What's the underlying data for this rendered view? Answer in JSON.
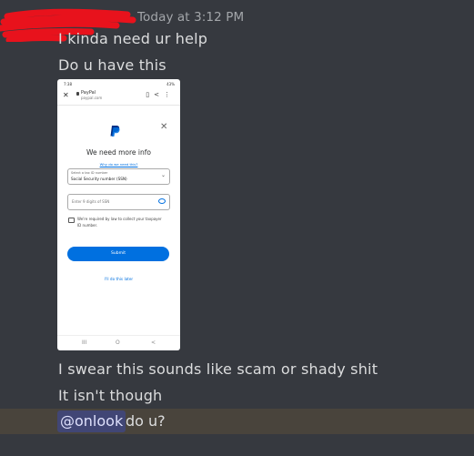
{
  "header": {
    "timestamp": "Today at 3:12 PM"
  },
  "messages": [
    "I kinda need ur help",
    "Do u have this",
    "I swear this sounds like scam or shady shit",
    "It isn't though"
  ],
  "mention_message": {
    "mention": "@onlook",
    "text": "do u?"
  },
  "attachment": {
    "status_left": "7:38",
    "status_right": "43%",
    "browser": {
      "site": "PayPal",
      "url": "paypal.com"
    },
    "paypal": {
      "title": "We need more info",
      "why_link": "Why do we need this?",
      "select_label": "Select a tax ID number",
      "select_value": "Social Security number (SSN)",
      "input_placeholder": "Enter 9 digits of SSN",
      "legal_text": "We're required by law to collect your taxpayer ID number.",
      "submit_label": "Submit",
      "later_link": "I'll do this later"
    },
    "nav": {
      "recent": "III",
      "home": "O",
      "back": "<"
    }
  },
  "colors": {
    "background": "#36393f",
    "text": "#dcddde",
    "highlight": "#49443c",
    "mention_bg": "#414675",
    "paypal_blue": "#0070e0"
  }
}
